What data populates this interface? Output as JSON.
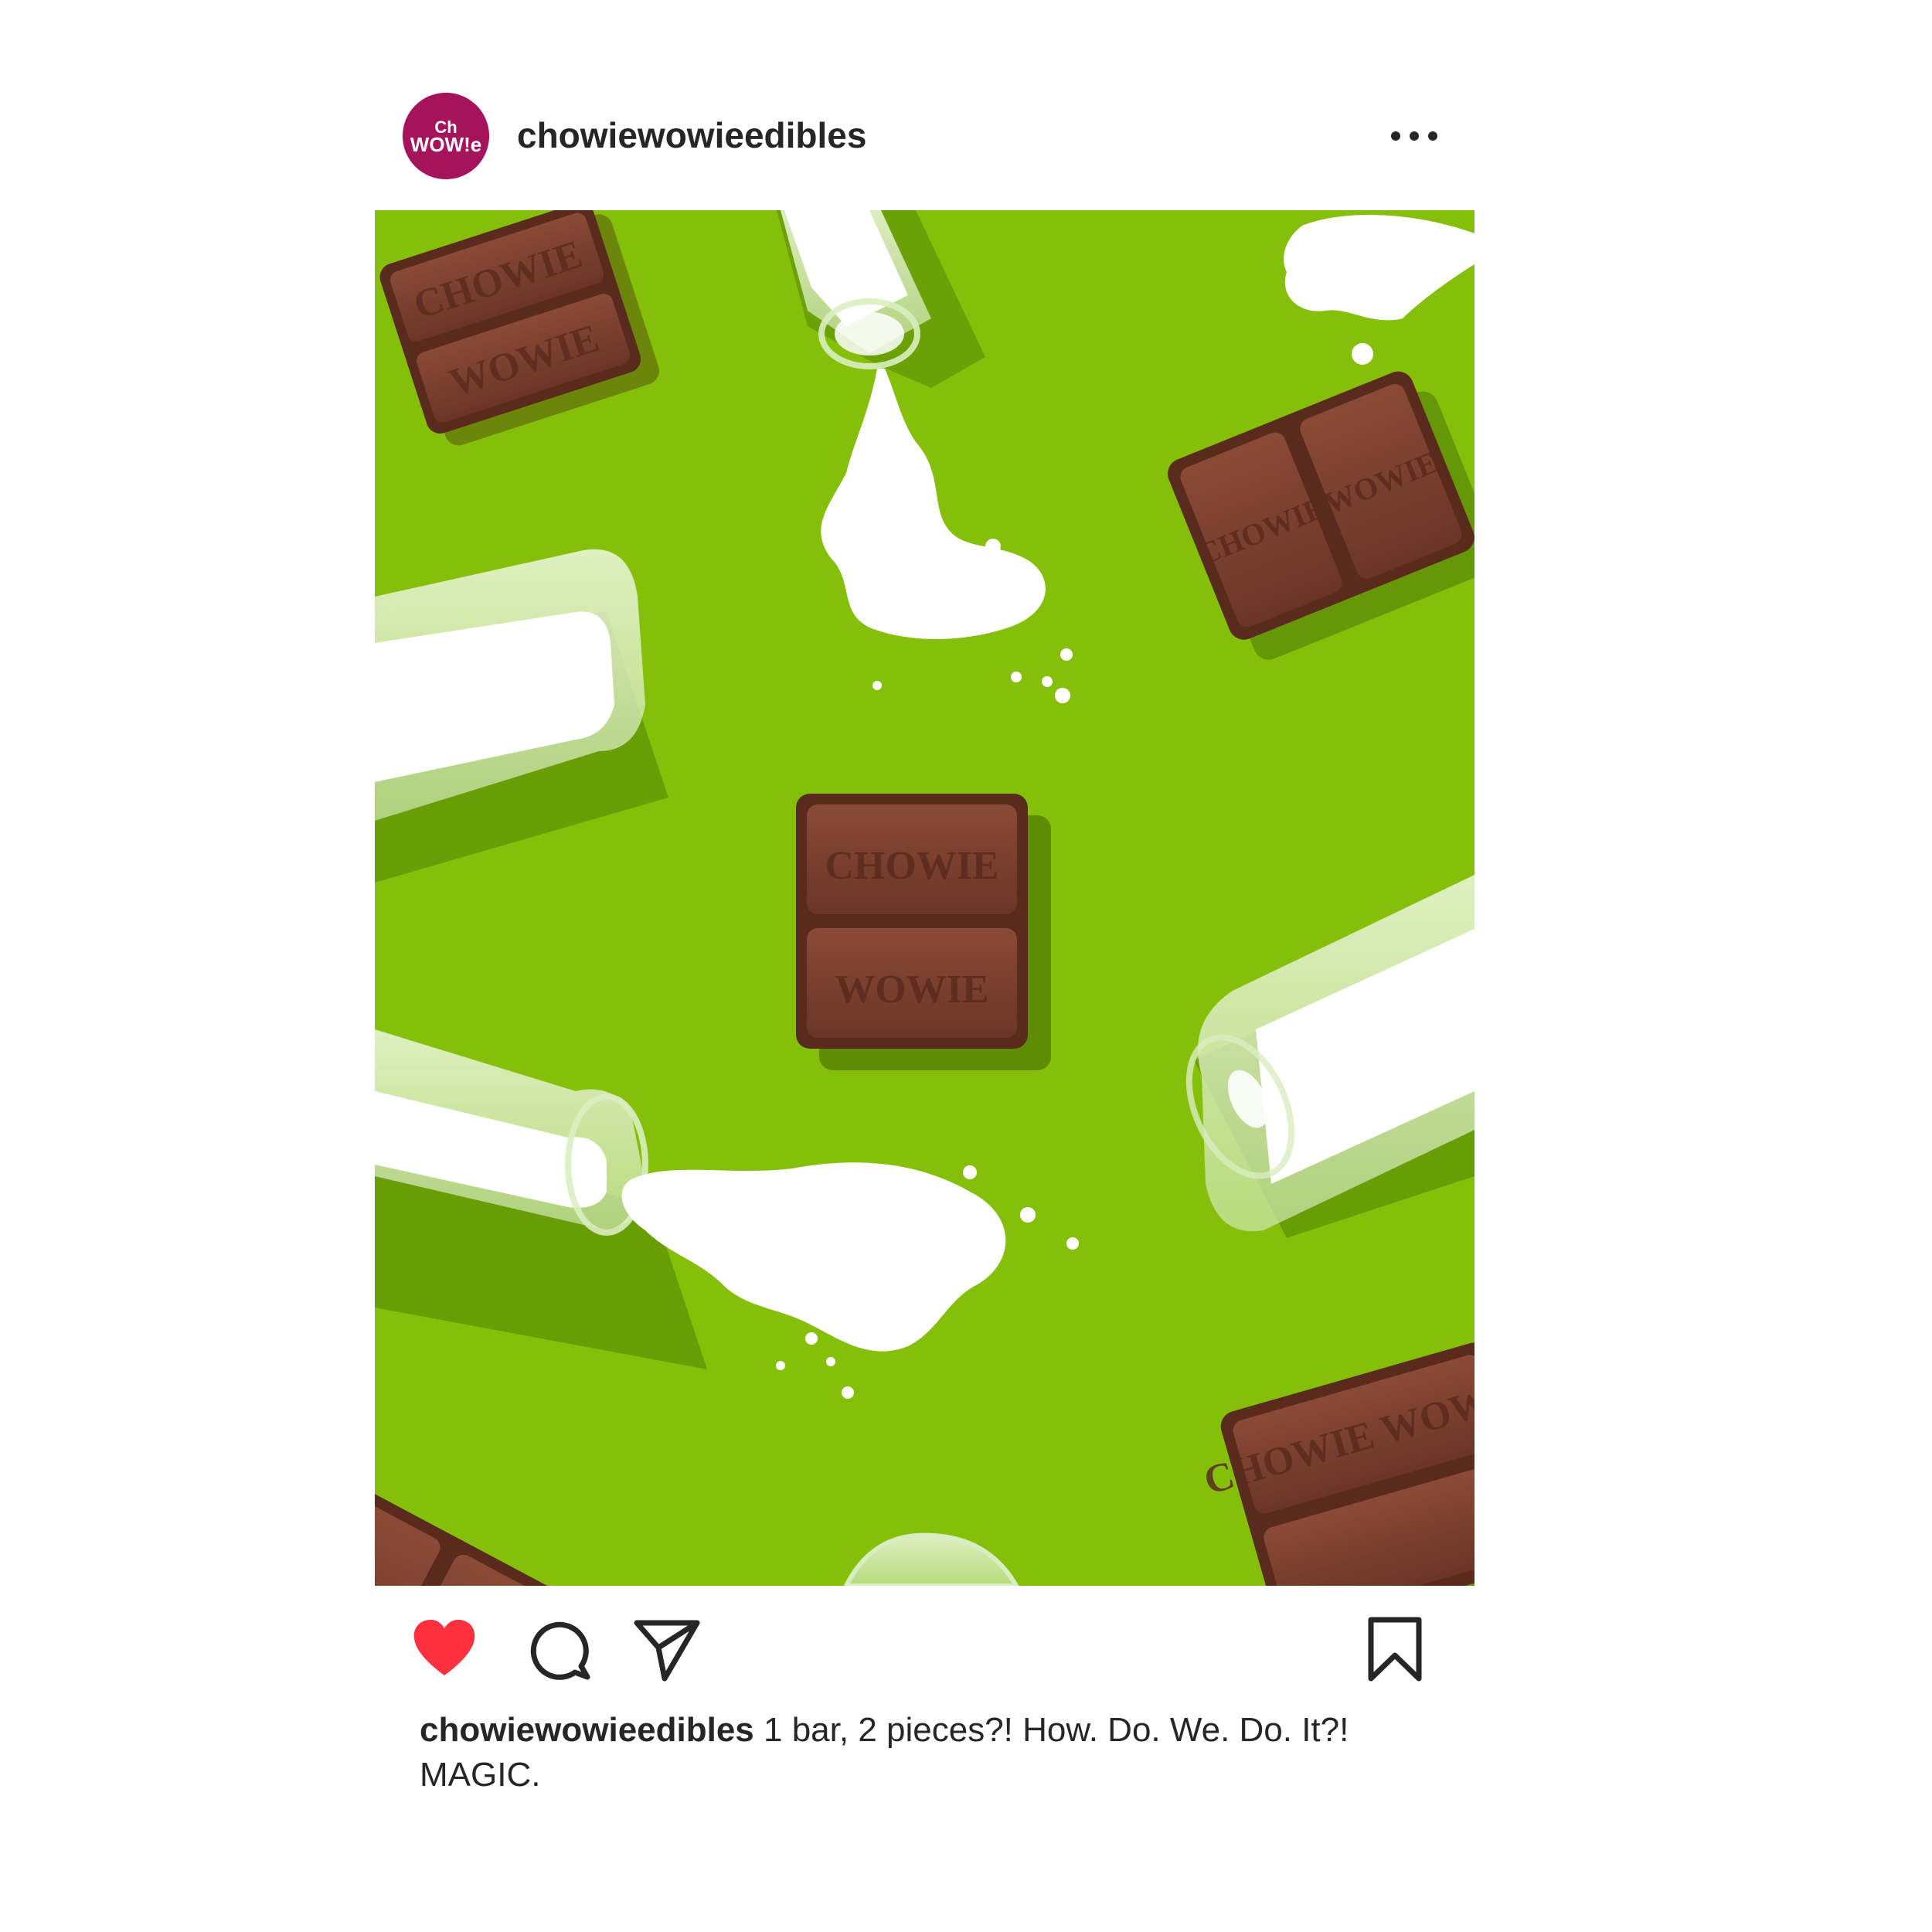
{
  "post": {
    "username": "chowiewowieedibles",
    "avatar_logo": "CHOWIE WOWIE",
    "caption_username": "chowiewowieedibles",
    "caption_text": " 1 bar, 2 pieces?! How. Do. We. Do. It?! MAGIC.",
    "liked": true,
    "photo_embossed_text": "CHOWIE WOWIE"
  },
  "icons": {
    "more": "more-options-icon",
    "like": "heart-filled-icon",
    "comment": "comment-bubble-icon",
    "share": "paper-plane-icon",
    "save": "bookmark-icon"
  },
  "colors": {
    "avatar_bg": "#a4135c",
    "like_red": "#ff3040",
    "photo_bg": "#85bf0a",
    "chocolate": "#6b3526",
    "milk": "#ffffff",
    "text": "#262626"
  }
}
